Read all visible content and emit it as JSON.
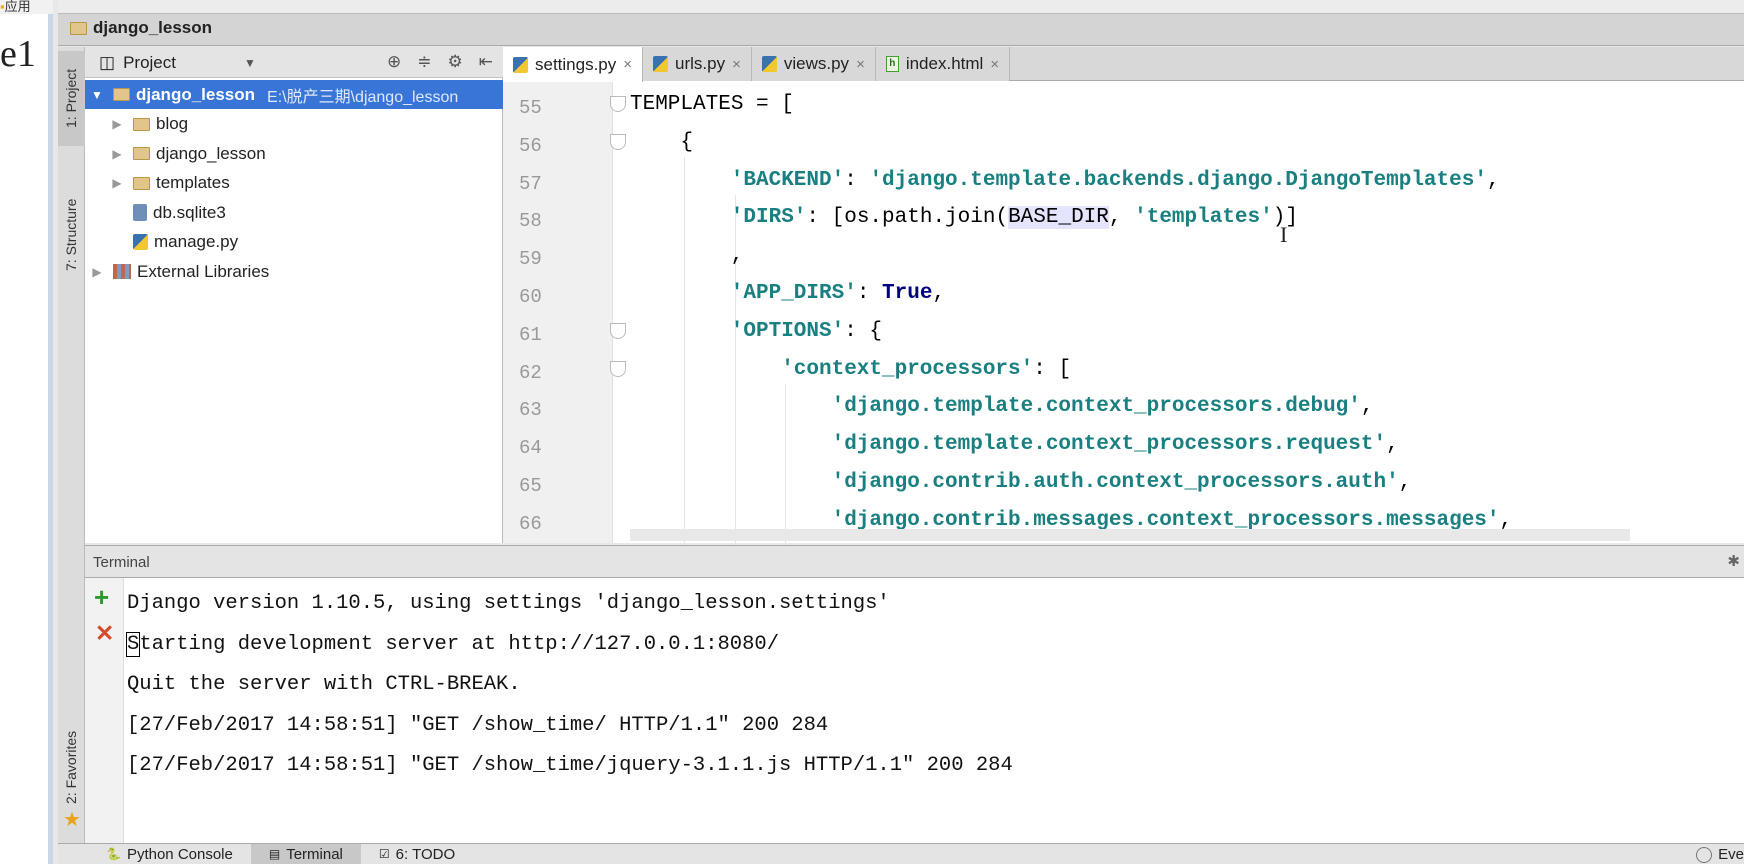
{
  "browser": {
    "apps_label": "应用",
    "page_text": "e1"
  },
  "navbar": {
    "breadcrumb": "django_lesson"
  },
  "left_strip": {
    "project": "1: Project",
    "structure": "7: Structure",
    "favorites": "2: Favorites"
  },
  "project_panel": {
    "title": "Project",
    "tree": [
      {
        "label": "django_lesson",
        "path": "E:\\脱产三期\\django_lesson",
        "icon": "folder-icon",
        "expanded": true,
        "selected": true
      },
      {
        "label": "blog",
        "icon": "package-folder-icon"
      },
      {
        "label": "django_lesson",
        "icon": "package-folder-icon"
      },
      {
        "label": "templates",
        "icon": "folder-icon"
      },
      {
        "label": "db.sqlite3",
        "icon": "database-icon"
      },
      {
        "label": "manage.py",
        "icon": "python-file-icon"
      },
      {
        "label": "External Libraries",
        "icon": "library-icon"
      }
    ]
  },
  "editor": {
    "tabs": [
      {
        "label": "settings.py",
        "icon": "python-file-icon",
        "active": true
      },
      {
        "label": "urls.py",
        "icon": "python-file-icon"
      },
      {
        "label": "views.py",
        "icon": "python-file-icon"
      },
      {
        "label": "index.html",
        "icon": "html-file-icon"
      }
    ],
    "lines": [
      {
        "n": "55",
        "indent": 0,
        "fold": true,
        "tokens": [
          {
            "t": "TEMPLATES = [",
            "c": "plain"
          }
        ]
      },
      {
        "n": "56",
        "indent": 1,
        "fold": true,
        "tokens": [
          {
            "t": "{",
            "c": "plain"
          }
        ]
      },
      {
        "n": "57",
        "indent": 2,
        "tokens": [
          {
            "t": "'BACKEND'",
            "c": "str"
          },
          {
            "t": ": ",
            "c": "plain"
          },
          {
            "t": "'django.template.backends.django.DjangoTemplates'",
            "c": "str"
          },
          {
            "t": ",",
            "c": "plain"
          }
        ]
      },
      {
        "n": "58",
        "indent": 2,
        "tokens": [
          {
            "t": "'DIRS'",
            "c": "str"
          },
          {
            "t": ": [os.path.join(",
            "c": "plain"
          },
          {
            "t": "BASE_DIR",
            "c": "hl"
          },
          {
            "t": ", ",
            "c": "plain"
          },
          {
            "t": "'templates'",
            "c": "str"
          },
          {
            "t": ")]",
            "c": "plain"
          }
        ]
      },
      {
        "n": "59",
        "indent": 2,
        "tokens": [
          {
            "t": ",",
            "c": "plain"
          }
        ]
      },
      {
        "n": "60",
        "indent": 2,
        "tokens": [
          {
            "t": "'APP_DIRS'",
            "c": "str"
          },
          {
            "t": ": ",
            "c": "plain"
          },
          {
            "t": "True",
            "c": "kw"
          },
          {
            "t": ",",
            "c": "plain"
          }
        ]
      },
      {
        "n": "61",
        "indent": 2,
        "fold": true,
        "tokens": [
          {
            "t": "'OPTIONS'",
            "c": "str"
          },
          {
            "t": ": {",
            "c": "plain"
          }
        ]
      },
      {
        "n": "62",
        "indent": 3,
        "fold": true,
        "tokens": [
          {
            "t": "'context_processors'",
            "c": "str"
          },
          {
            "t": ": [",
            "c": "plain"
          }
        ]
      },
      {
        "n": "63",
        "indent": 4,
        "tokens": [
          {
            "t": "'django.template.context_processors.debug'",
            "c": "str"
          },
          {
            "t": ",",
            "c": "plain"
          }
        ]
      },
      {
        "n": "64",
        "indent": 4,
        "tokens": [
          {
            "t": "'django.template.context_processors.request'",
            "c": "str"
          },
          {
            "t": ",",
            "c": "plain"
          }
        ]
      },
      {
        "n": "65",
        "indent": 4,
        "tokens": [
          {
            "t": "'django.contrib.auth.context_processors.auth'",
            "c": "str"
          },
          {
            "t": ",",
            "c": "plain"
          }
        ]
      },
      {
        "n": "66",
        "indent": 4,
        "tokens": [
          {
            "t": "'django.contrib.messages.context_processors.messages'",
            "c": "str"
          },
          {
            "t": ",",
            "c": "plain"
          }
        ]
      }
    ]
  },
  "terminal": {
    "title": "Terminal",
    "lines": [
      "Django version 1.10.5, using settings 'django_lesson.settings'",
      "Starting development server at http://127.0.0.1:8080/",
      "Quit the server with CTRL-BREAK.",
      "[27/Feb/2017 14:58:51] \"GET /show_time/ HTTP/1.1\" 200 284",
      "[27/Feb/2017 14:58:51] \"GET /show_time/jquery-3.1.1.js HTTP/1.1\" 200 284"
    ]
  },
  "bottom_bar": {
    "tabs": [
      {
        "label": "Python Console"
      },
      {
        "label": "Terminal",
        "active": true
      },
      {
        "label": "6: TODO"
      }
    ],
    "event_log": "Eve"
  }
}
